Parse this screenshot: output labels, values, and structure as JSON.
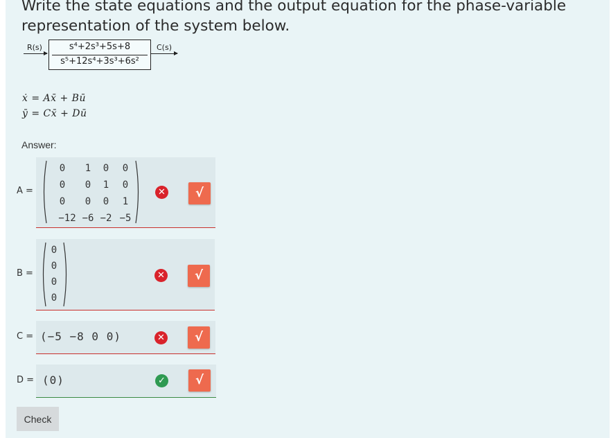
{
  "question": {
    "line1": "Write the state equations and the output equation for the phase-variable",
    "line2": "representation of the system below."
  },
  "transfer_function": {
    "input_label": "R(s)",
    "output_label": "C(s)",
    "numerator": "s⁴+2s³+5s+8",
    "denominator": "s⁵+12s⁴+3s³+6s²"
  },
  "equations": {
    "state": "ẋ = Ax̄ + Bū",
    "output": "ȳ = Cx̄ + Dū"
  },
  "answer_label": "Answer:",
  "fields": {
    "A": {
      "label": "A =",
      "rows": [
        [
          "0",
          "1",
          "0",
          "0"
        ],
        [
          "0",
          "0",
          "1",
          "0"
        ],
        [
          "0",
          "0",
          "0",
          "1"
        ],
        [
          "−12",
          "−6",
          "−2",
          "−5"
        ]
      ],
      "status": "wrong"
    },
    "B": {
      "label": "B =",
      "rows": [
        [
          "0"
        ],
        [
          "0"
        ],
        [
          "0"
        ],
        [
          "0"
        ]
      ],
      "status": "wrong"
    },
    "C": {
      "label": "C =",
      "value": "(−5 −8 0 0)",
      "status": "wrong"
    },
    "D": {
      "label": "D =",
      "value": "(0)",
      "status": "correct"
    }
  },
  "icons": {
    "wrong": "✕",
    "correct": "✓",
    "sqrt": "√"
  },
  "colors": {
    "wrong": "#d9232b",
    "correct": "#2f9a52",
    "sqrt_button": "#ee6a4e"
  },
  "check_button": "Check"
}
